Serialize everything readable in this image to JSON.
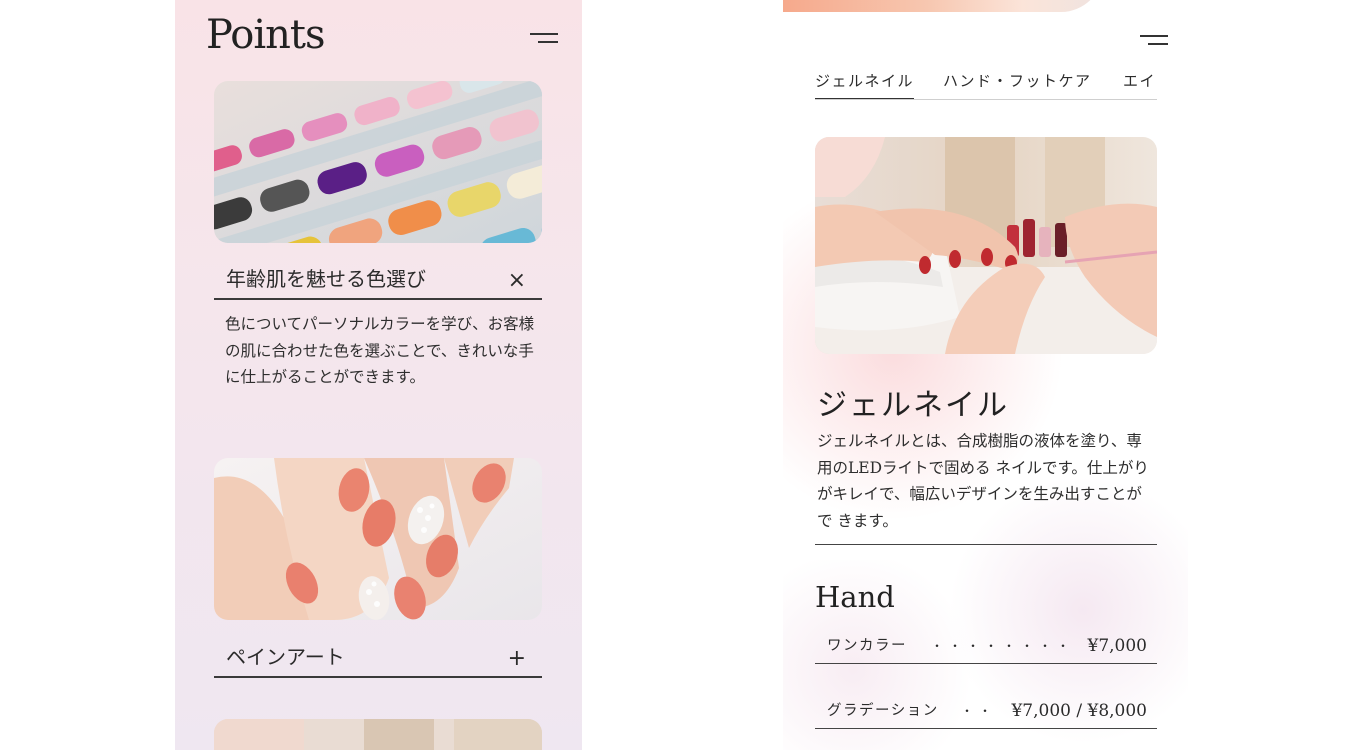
{
  "left_screen": {
    "title": "Points",
    "menu_icon": "hamburger-icon",
    "items": [
      {
        "title": "年齢肌を魅せる色選び",
        "expanded": true,
        "icon_glyph": "×",
        "icon": "close-icon",
        "body": "色についてパーソナルカラーを学び、お客様 の肌に合わせた色を選ぶことで、きれいな手 に仕上がることができます。"
      },
      {
        "title": "ペインアート",
        "expanded": false,
        "icon_glyph": "+",
        "icon": "plus-icon"
      }
    ]
  },
  "right_screen": {
    "menu_icon": "hamburger-icon",
    "tabs": [
      {
        "label": "ジェルネイル",
        "active": true
      },
      {
        "label": "ハンド・フットケア",
        "active": false
      },
      {
        "label": "エイ",
        "active": false
      }
    ],
    "section": {
      "title": "ジェルネイル",
      "description": "ジェルネイルとは、合成樹脂の液体を塗り、専用のLEDライトで固める ネイルです。仕上がりがキレイで、幅広いデザインを生み出すことがで きます。"
    },
    "price_section": {
      "title": "Hand",
      "rows": [
        {
          "name": "ワンカラー",
          "dots": "・・・・・・・・",
          "price": "¥7,000"
        },
        {
          "name": "グラデーション",
          "dots": "・・",
          "price": "¥7,000 / ¥8,000"
        }
      ]
    }
  }
}
